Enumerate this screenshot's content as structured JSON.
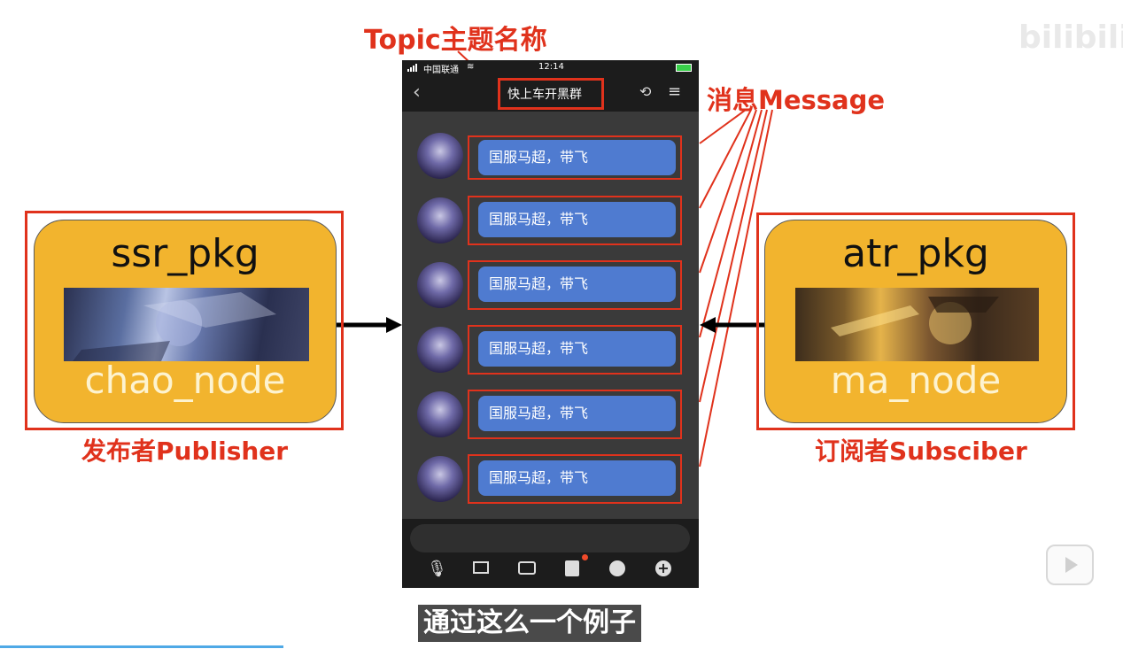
{
  "topic_label": "Topic主题名称",
  "message_label": "消息Message",
  "publisher": {
    "pkg": "ssr_pkg",
    "node": "chao_node",
    "caption": "发布者Publisher"
  },
  "subscriber": {
    "pkg": "atr_pkg",
    "node": "ma_node",
    "caption": "订阅者Subsciber"
  },
  "phone": {
    "carrier": "中国联通",
    "time": "12:14",
    "chat_title": "快上车开黑群",
    "messages": [
      "国服马超，带飞",
      "国服马超，带飞",
      "国服马超，带飞",
      "国服马超，带飞",
      "国服马超，带飞",
      "国服马超，带飞"
    ]
  },
  "subtitle": "通过这么一个例子",
  "watermark": "bilibili",
  "colors": {
    "accent_red": "#e0321c",
    "node_yellow": "#f2b42e",
    "bubble_blue": "#4f7bd0",
    "phone_bg": "#3a3a3a"
  }
}
